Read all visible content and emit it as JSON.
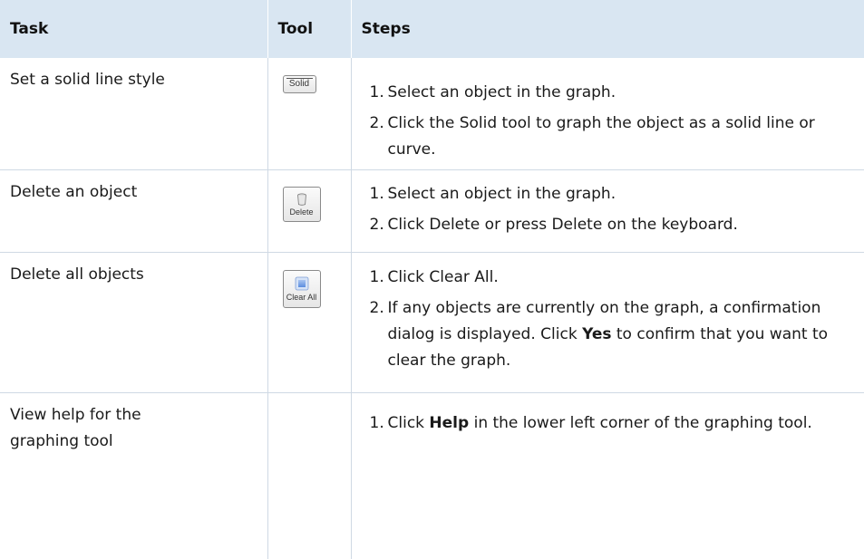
{
  "headers": {
    "task": "Task",
    "tool": "Tool",
    "steps": "Steps"
  },
  "rows": [
    {
      "task": "Set a solid line style",
      "tool": {
        "label": "Solid",
        "icon": "solid-line-icon"
      },
      "steps": [
        {
          "num": "1.",
          "text": "Select an object in the graph."
        },
        {
          "num": "2.",
          "text": "Click the Solid tool to graph the object as a solid line or curve."
        }
      ]
    },
    {
      "task": "Delete an object",
      "tool": {
        "label": "Delete",
        "icon": "trash-can-icon"
      },
      "steps": [
        {
          "num": "1.",
          "text": "Select an object in the graph."
        },
        {
          "num": "2.",
          "text": "Click Delete or press Delete on the keyboard."
        }
      ]
    },
    {
      "task": "Delete all objects",
      "tool": {
        "label": "Clear All",
        "icon": "clear-all-icon"
      },
      "steps": [
        {
          "num": "1.",
          "text": "Click Clear All."
        },
        {
          "num": "2.",
          "before": "If any objects are currently on the graph, a confirmation dialog is displayed. Click ",
          "bold": "Yes",
          "after": " to confirm that you want to clear the graph."
        }
      ]
    },
    {
      "task": "View help for the graphing tool",
      "steps": [
        {
          "num": "1.",
          "before": "Click ",
          "bold": "Help",
          "after": " in the lower left corner of the graphing tool."
        }
      ]
    }
  ]
}
